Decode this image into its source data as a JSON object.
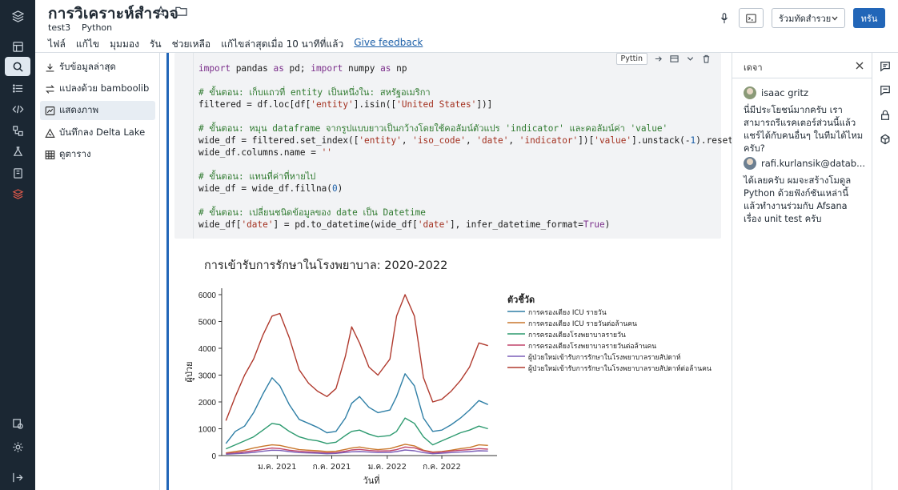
{
  "header": {
    "title": "การวิเคราะห์สำรวจ",
    "breadcrumb": "test3",
    "language": "Python",
    "menu": [
      "ไฟล์",
      "แก้ไข",
      "มุมมอง",
      "รัน",
      "ช่วยเหลือ"
    ],
    "last_edit": "แก้ไขล่าสุดเมื่อ 10 นาทีที่แล้ว",
    "feedback": "Give feedback",
    "cluster_select": "รัวมทัดสำรวย",
    "run_button": "ทรัน"
  },
  "sidebar": {
    "items": [
      {
        "label": "รับข้อมูลล่าสุด",
        "icon": "download-icon"
      },
      {
        "label": "แปลงด้วย bamboolib",
        "icon": "transform-icon"
      },
      {
        "label": "แสดงภาพ",
        "icon": "chart-icon"
      },
      {
        "label": "บันทึกลง Delta Lake",
        "icon": "delta-icon"
      },
      {
        "label": "ดูตาราง",
        "icon": "table-icon"
      }
    ]
  },
  "cell": {
    "language_badge": "Pyttin",
    "code": [
      [
        {
          "t": "import",
          "c": "kw"
        },
        {
          "t": " pandas "
        },
        {
          "t": "as",
          "c": "kw"
        },
        {
          "t": " pd; "
        },
        {
          "t": "import",
          "c": "kw"
        },
        {
          "t": " numpy "
        },
        {
          "t": "as",
          "c": "kw"
        },
        {
          "t": " np"
        }
      ],
      [],
      [
        {
          "t": "# ขั้นตอน: เก็บแถวที่ entity เป็นหนึ่งใน: สหรัฐอเมริกา",
          "c": "cm"
        }
      ],
      [
        {
          "t": "filtered = df.loc[df["
        },
        {
          "t": "'entity'",
          "c": "st"
        },
        {
          "t": "].isin(["
        },
        {
          "t": "'United States'",
          "c": "st"
        },
        {
          "t": "])]"
        }
      ],
      [],
      [
        {
          "t": "# ขั้นตอน: หมุน dataframe จากรูปแบบยาวเป็นกว้างโดยใช้คอลัมน์ตัวแปร 'indicator' และคอลัมน์ค่า 'value'",
          "c": "cm"
        }
      ],
      [
        {
          "t": "wide_df = filtered.set_index(["
        },
        {
          "t": "'entity'",
          "c": "st"
        },
        {
          "t": ", "
        },
        {
          "t": "'iso_code'",
          "c": "st"
        },
        {
          "t": ", "
        },
        {
          "t": "'date'",
          "c": "st"
        },
        {
          "t": ", "
        },
        {
          "t": "'indicator'",
          "c": "st"
        },
        {
          "t": "])["
        },
        {
          "t": "'value'",
          "c": "st"
        },
        {
          "t": "].unstack(-"
        },
        {
          "t": "1",
          "c": "nm"
        },
        {
          "t": ").reset_index()"
        }
      ],
      [
        {
          "t": "wide_df.columns.name = "
        },
        {
          "t": "''",
          "c": "st"
        }
      ],
      [],
      [
        {
          "t": "# ขั้นตอน: แทนที่ค่าที่หายไป",
          "c": "cm"
        }
      ],
      [
        {
          "t": "wide_df = wide_df.fillna("
        },
        {
          "t": "0",
          "c": "nm"
        },
        {
          "t": ")"
        }
      ],
      [],
      [
        {
          "t": "# ขั้นตอน: เปลี่ยนชนิดข้อมูลของ date เป็น Datetime",
          "c": "cm"
        }
      ],
      [
        {
          "t": "wide_df["
        },
        {
          "t": "'date'",
          "c": "st"
        },
        {
          "t": "] = pd.to_datetime(wide_df["
        },
        {
          "t": "'date'",
          "c": "st"
        },
        {
          "t": "], infer_datetime_format="
        },
        {
          "t": "True",
          "c": "kw"
        },
        {
          "t": ")"
        }
      ]
    ]
  },
  "chart_data": {
    "type": "line",
    "title": "การเข้ารับการรักษาในโรงพยาบาล: 2020-2022",
    "xlabel": "วันที่",
    "ylabel": "ผู้ป่วย",
    "ylim": [
      0,
      6000
    ],
    "yticks": [
      0,
      1000,
      2000,
      3000,
      4000,
      5000,
      6000
    ],
    "xticks": [
      "ม.ค. 2021",
      "ก.ค. 2021",
      "ม.ค. 2022",
      "ก.ค. 2022"
    ],
    "xticks_pos": [
      "2021-01-01",
      "2021-07-01",
      "2022-01-01",
      "2022-07-01"
    ],
    "legend_title": "ตัวชี้วัด",
    "legend_position": "right",
    "x": [
      "2020-07-15",
      "2020-08-15",
      "2020-09-15",
      "2020-10-15",
      "2020-11-15",
      "2020-12-15",
      "2021-01-10",
      "2021-02-10",
      "2021-03-15",
      "2021-04-15",
      "2021-05-15",
      "2021-06-15",
      "2021-07-15",
      "2021-08-15",
      "2021-09-05",
      "2021-10-01",
      "2021-11-01",
      "2021-12-01",
      "2022-01-10",
      "2022-02-01",
      "2022-03-01",
      "2022-04-01",
      "2022-05-01",
      "2022-06-01",
      "2022-07-01",
      "2022-08-01",
      "2022-09-01",
      "2022-10-01",
      "2022-11-01",
      "2022-12-01"
    ],
    "series": [
      {
        "name": "การครองเตียง ICU รายวัน",
        "color": "#2f7fa6",
        "values": [
          450,
          900,
          1100,
          1600,
          2300,
          2900,
          2600,
          1900,
          1350,
          1200,
          1050,
          850,
          900,
          1400,
          1950,
          2200,
          1800,
          1600,
          1700,
          2200,
          3050,
          2600,
          1400,
          900,
          950,
          1150,
          1400,
          1700,
          2050,
          1900
        ]
      },
      {
        "name": "การครองเตียง ICU รายวันต่อล้านคน",
        "color": "#c9772b",
        "values": [
          100,
          150,
          200,
          280,
          350,
          400,
          380,
          300,
          220,
          200,
          180,
          150,
          160,
          230,
          280,
          320,
          260,
          220,
          260,
          330,
          420,
          360,
          200,
          130,
          150,
          200,
          260,
          300,
          400,
          380
        ]
      },
      {
        "name": "การครองเตียงโรงพยาบาลรายวัน",
        "color": "#2d9a6f",
        "values": [
          250,
          400,
          550,
          700,
          950,
          1200,
          1150,
          900,
          700,
          600,
          550,
          450,
          500,
          750,
          900,
          950,
          800,
          700,
          750,
          900,
          1400,
          1200,
          700,
          400,
          550,
          700,
          850,
          950,
          1100,
          1000
        ]
      },
      {
        "name": "การครองเตียงโรงพยาบาลรายวันต่อล้านคน",
        "color": "#c0446a",
        "values": [
          80,
          100,
          140,
          180,
          230,
          280,
          260,
          200,
          160,
          140,
          120,
          100,
          110,
          160,
          210,
          230,
          190,
          170,
          180,
          220,
          320,
          290,
          180,
          110,
          130,
          170,
          200,
          220,
          260,
          240
        ]
      },
      {
        "name": "ผู้ป่วยใหม่เข้ารับการรักษาในโรงพยาบาลรายสัปดาห์",
        "color": "#7c5fb8",
        "values": [
          50,
          70,
          90,
          120,
          160,
          200,
          190,
          150,
          110,
          100,
          90,
          70,
          80,
          120,
          140,
          150,
          130,
          110,
          120,
          150,
          210,
          180,
          110,
          70,
          90,
          110,
          130,
          150,
          180,
          170
        ]
      },
      {
        "name": "ผู้ป่วยใหม่เข้ารับการรักษาในโรงพยาบาลรายสัปดาห์ต่อล้านคน",
        "color": "#b03a2e",
        "values": [
          1300,
          2200,
          3000,
          3600,
          4500,
          5200,
          5300,
          4400,
          3200,
          2700,
          2400,
          2200,
          2500,
          3700,
          4800,
          4200,
          3300,
          3000,
          3600,
          5200,
          6000,
          5200,
          2900,
          2000,
          2100,
          2400,
          2800,
          3300,
          4200,
          4100
        ]
      }
    ]
  },
  "comments": {
    "title": "เดจา",
    "items": [
      {
        "author": "isaac gritz",
        "text": "นี่มีประโยชน์มากครับ เราสามารถรีแรคเตอร์ส่วนนี้แล้วแชร์ได้กับคนอื่นๆ ในทีมได้ไหมครับ?"
      },
      {
        "author": "rafi.kurlansik@datab...",
        "text": "ได้เลยครับ ผมจะสร้างโมดูล Python ด้วยฟังก์ชันเหล่านี้ แล้วทำงานร่วมกับ Afsana เรื่อง unit test ครับ"
      }
    ]
  }
}
